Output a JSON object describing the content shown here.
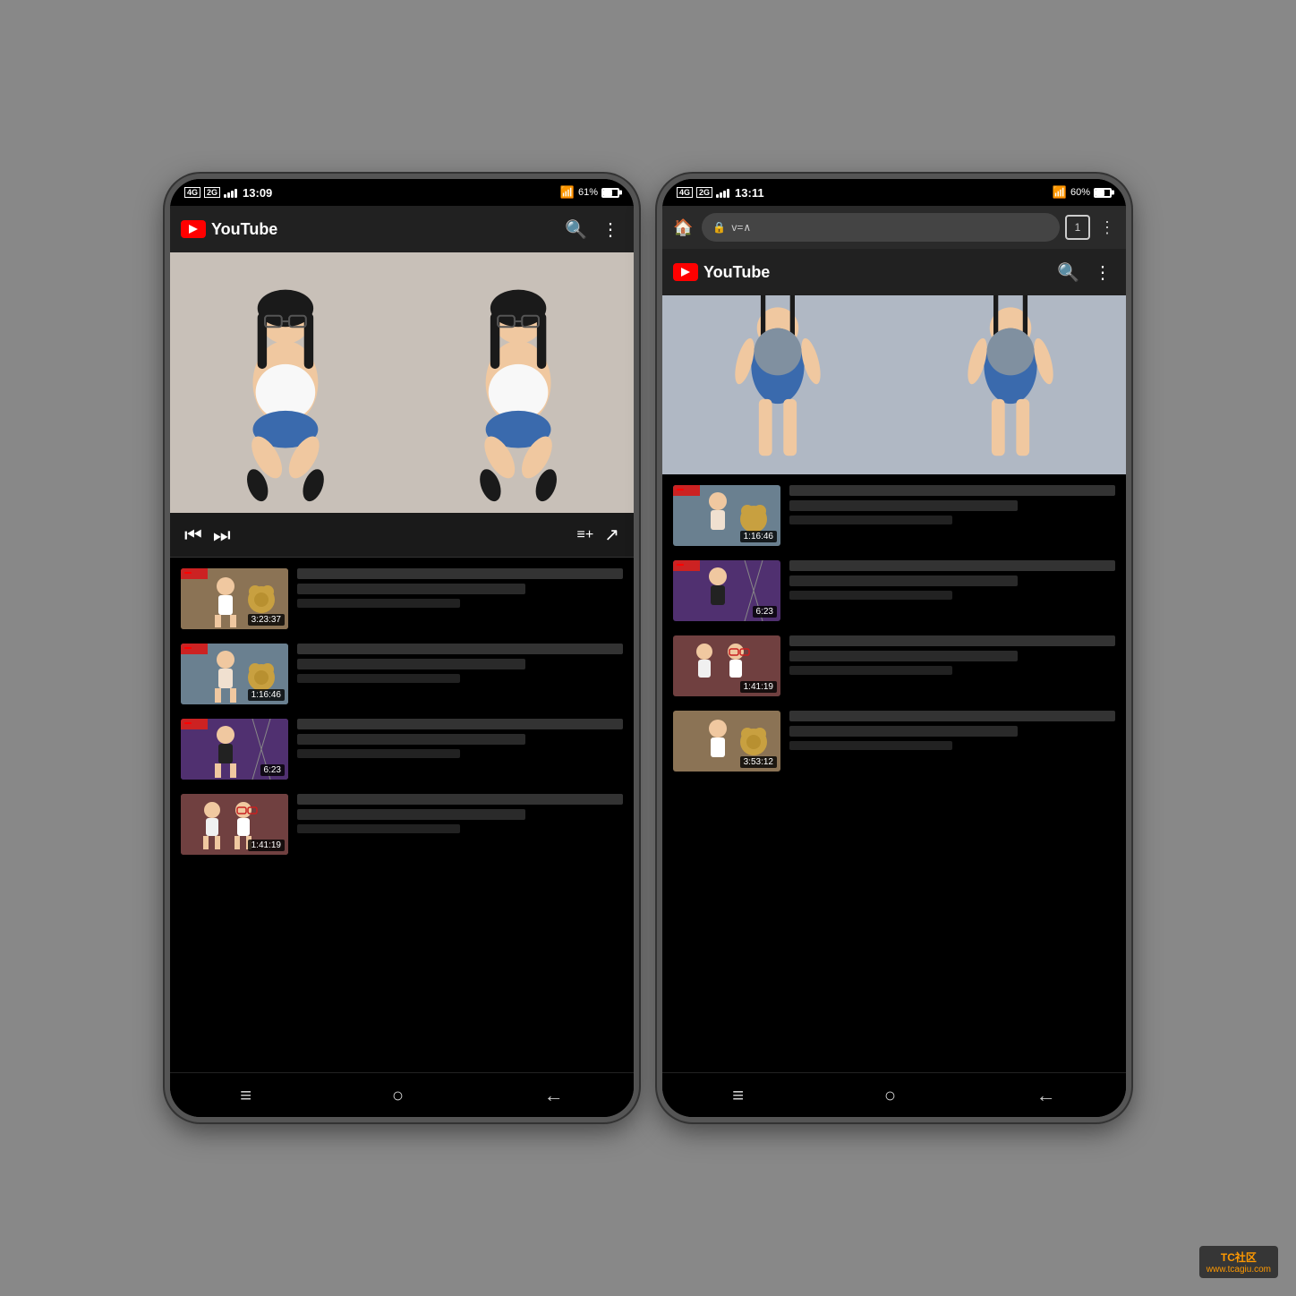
{
  "phone1": {
    "status": {
      "time": "13:09",
      "battery": "61%",
      "signal": "4G",
      "signal2": "2G"
    },
    "header": {
      "title": "YouTube",
      "logo_label": "YouTube logo"
    },
    "controls": {
      "prev_label": "⏮",
      "next_label": "⏭",
      "playlist_label": "≡+",
      "share_label": "↗"
    },
    "videos": [
      {
        "duration": "3:23:37",
        "has_live": true,
        "thumb_class": "thumb-1"
      },
      {
        "duration": "1:16:46",
        "has_live": true,
        "thumb_class": "thumb-2"
      },
      {
        "duration": "6:23",
        "has_live": true,
        "thumb_class": "thumb-3"
      },
      {
        "duration": "1:41:19",
        "has_live": false,
        "thumb_class": "thumb-4"
      }
    ],
    "nav": {
      "menu": "≡",
      "home": "○",
      "back": "←"
    }
  },
  "phone2": {
    "status": {
      "time": "13:11",
      "battery": "60%",
      "signal": "4G",
      "signal2": "2G"
    },
    "browser": {
      "url": "v=∧",
      "tab_count": "1",
      "home_icon": "🏠",
      "lock_icon": "🔒"
    },
    "header": {
      "title": "YouTube",
      "logo_label": "YouTube logo"
    },
    "videos": [
      {
        "duration": "1:16:46",
        "has_live": true,
        "thumb_class": "thumb-2"
      },
      {
        "duration": "6:23",
        "has_live": true,
        "thumb_class": "thumb-3"
      },
      {
        "duration": "1:41:19",
        "has_live": false,
        "thumb_class": "thumb-4"
      },
      {
        "duration": "3:53:12",
        "has_live": false,
        "thumb_class": "thumb-1"
      }
    ],
    "nav": {
      "menu": "≡",
      "home": "○",
      "back": "←"
    }
  },
  "watermark": {
    "site": "www.tcagiu.com",
    "label": "TC社区"
  }
}
